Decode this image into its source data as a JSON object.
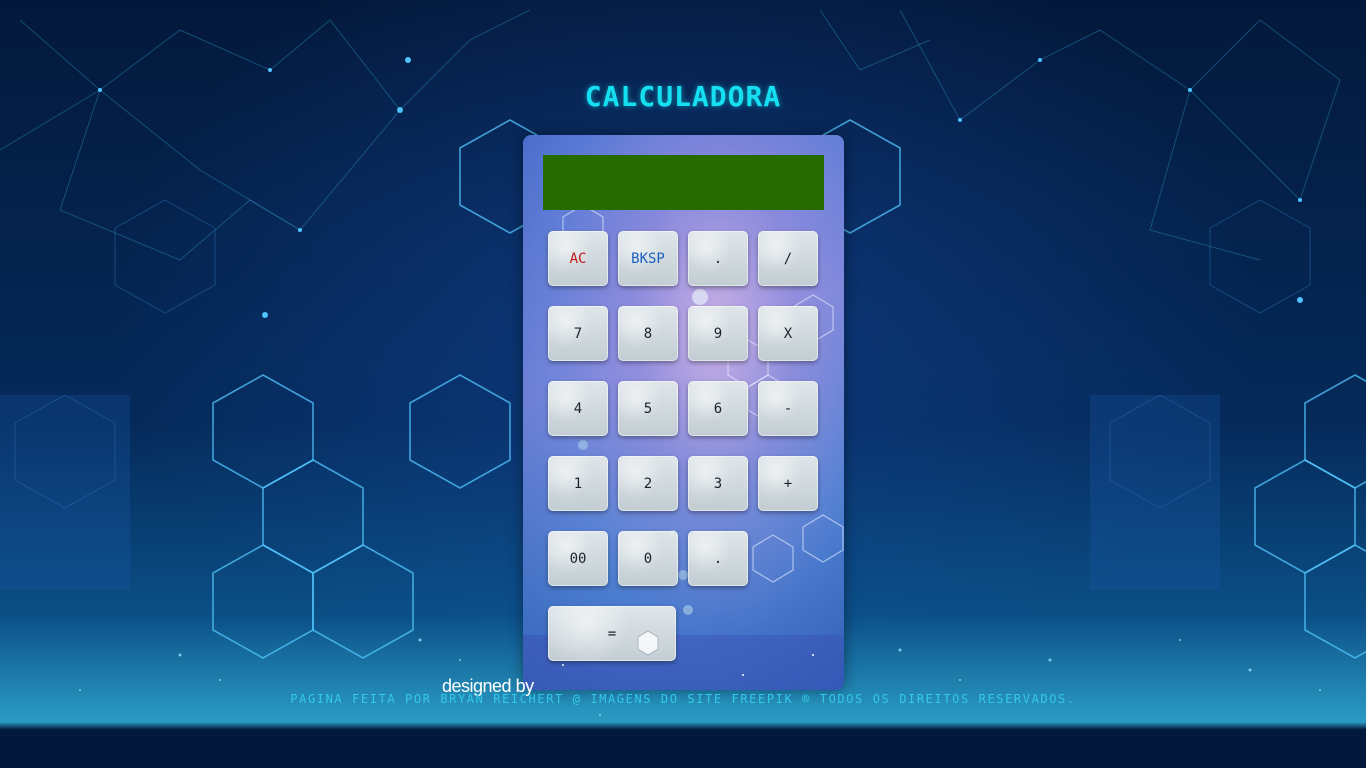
{
  "title": "CALCULADORA",
  "display": {
    "value": ""
  },
  "keys": {
    "row1": [
      "AC",
      "BKSP",
      ".",
      "/"
    ],
    "row2": [
      "7",
      "8",
      "9",
      "X"
    ],
    "row3": [
      "4",
      "5",
      "6",
      "-"
    ],
    "row4": [
      "1",
      "2",
      "3",
      "+"
    ],
    "row5": [
      "00",
      "0",
      "."
    ],
    "row6": [
      "="
    ]
  },
  "designed_by": "designed by",
  "footer": "PAGINA FEITA POR BRYAN REICHERT @ IMAGENS DO SITE FREEPIK ® TODOS OS DIREITOS RESERVADOS.",
  "colors": {
    "display_bg": "#266b00",
    "title": "#14e0f2",
    "ac_label": "#c01818",
    "bksp_label": "#1a5fc0"
  }
}
